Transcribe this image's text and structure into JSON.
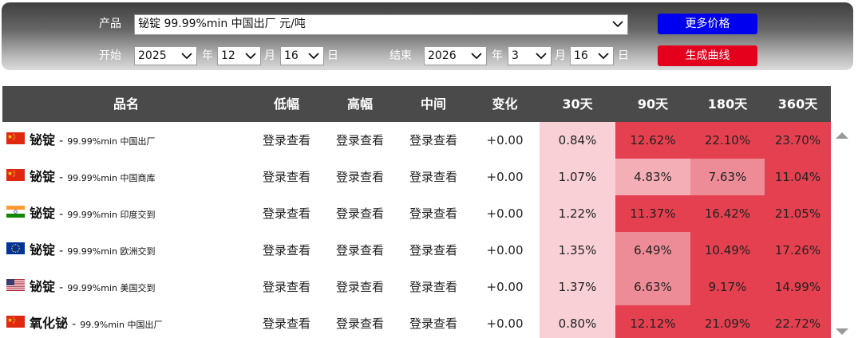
{
  "controls": {
    "product_label": "产品",
    "product_value": "铋锭 99.99%min 中国出厂 元/吨",
    "start_label": "开始",
    "end_label": "结束",
    "year_unit": "年",
    "month_unit": "月",
    "day_unit": "日",
    "start_year": "2025",
    "start_month": "12",
    "start_day": "16",
    "end_year": "2026",
    "end_month": "3",
    "end_day": "16",
    "more_prices_button": "更多价格",
    "generate_curve_button": "生成曲线"
  },
  "table": {
    "headers": {
      "name": "品名",
      "low": "低幅",
      "high": "高幅",
      "mid": "中间",
      "change": "变化",
      "d30": "30天",
      "d90": "90天",
      "d180": "180天",
      "d360": "360天"
    },
    "rows": [
      {
        "flag": "china",
        "name": "铋锭",
        "dash": "-",
        "desc": "99.99%min 中国出厂",
        "low": "登录查看",
        "high": "登录查看",
        "mid": "登录查看",
        "change": "+0.00",
        "d30": "0.84%",
        "d90": "12.62%",
        "d180": "22.10%",
        "d360": "23.70%"
      },
      {
        "flag": "china",
        "name": "铋锭",
        "dash": "-",
        "desc": "99.99%min 中国商库",
        "low": "登录查看",
        "high": "登录查看",
        "mid": "登录查看",
        "change": "+0.00",
        "d30": "1.07%",
        "d90": "4.83%",
        "d180": "7.63%",
        "d360": "11.04%"
      },
      {
        "flag": "india",
        "name": "铋锭",
        "dash": "-",
        "desc": "99.99%min 印度交到",
        "low": "登录查看",
        "high": "登录查看",
        "mid": "登录查看",
        "change": "+0.00",
        "d30": "1.22%",
        "d90": "11.37%",
        "d180": "16.42%",
        "d360": "21.05%"
      },
      {
        "flag": "eu",
        "name": "铋锭",
        "dash": "-",
        "desc": "99.99%min 欧洲交到",
        "low": "登录查看",
        "high": "登录查看",
        "mid": "登录查看",
        "change": "+0.00",
        "d30": "1.35%",
        "d90": "6.49%",
        "d180": "10.49%",
        "d360": "17.26%"
      },
      {
        "flag": "usa",
        "name": "铋锭",
        "dash": "-",
        "desc": "99.99%min 美国交到",
        "low": "登录查看",
        "high": "登录查看",
        "mid": "登录查看",
        "change": "+0.00",
        "d30": "1.37%",
        "d90": "6.63%",
        "d180": "9.17%",
        "d360": "14.99%"
      },
      {
        "flag": "china",
        "name": "氧化铋",
        "dash": "-",
        "desc": "99.9%min 中国出厂",
        "low": "登录查看",
        "high": "登录查看",
        "mid": "登录查看",
        "change": "+0.00",
        "d30": "0.80%",
        "d90": "12.12%",
        "d180": "21.09%",
        "d360": "22.72%"
      }
    ]
  },
  "colors": {
    "heat_low": "#f9d0d6",
    "heat_mid": "#ed8c97",
    "heat_high": "#e5404f"
  }
}
